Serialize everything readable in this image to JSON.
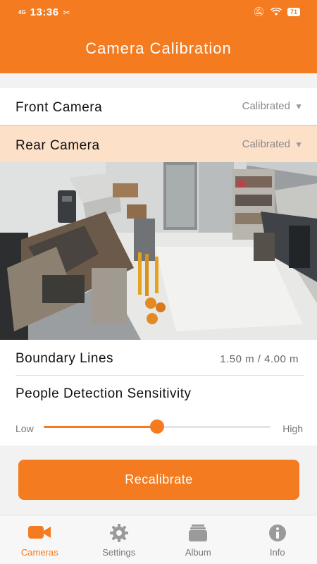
{
  "status_bar": {
    "signal": "4G",
    "time": "13:36",
    "battery": "71"
  },
  "header": {
    "title": "Camera Calibration"
  },
  "cameras": [
    {
      "name": "Front Camera",
      "status": "Calibrated",
      "expanded": false
    },
    {
      "name": "Rear Camera",
      "status": "Calibrated",
      "expanded": true
    }
  ],
  "settings": {
    "boundary_label": "Boundary Lines",
    "boundary_value": "1.50  m  /  4.00  m",
    "sensitivity_label": "People  Detection  Sensitivity",
    "slider_low": "Low",
    "slider_high": "High",
    "sensitivity_level": 0.5
  },
  "recalibrate_label": "Recalibrate",
  "tabs": [
    {
      "label": "Cameras",
      "icon": "video-camera-icon",
      "active": true
    },
    {
      "label": "Settings",
      "icon": "gear-icon",
      "active": false
    },
    {
      "label": "Album",
      "icon": "album-icon",
      "active": false
    },
    {
      "label": "Info",
      "icon": "info-icon",
      "active": false
    }
  ],
  "colors": {
    "accent": "#f47b1f",
    "selected_row": "#fde0c8"
  }
}
